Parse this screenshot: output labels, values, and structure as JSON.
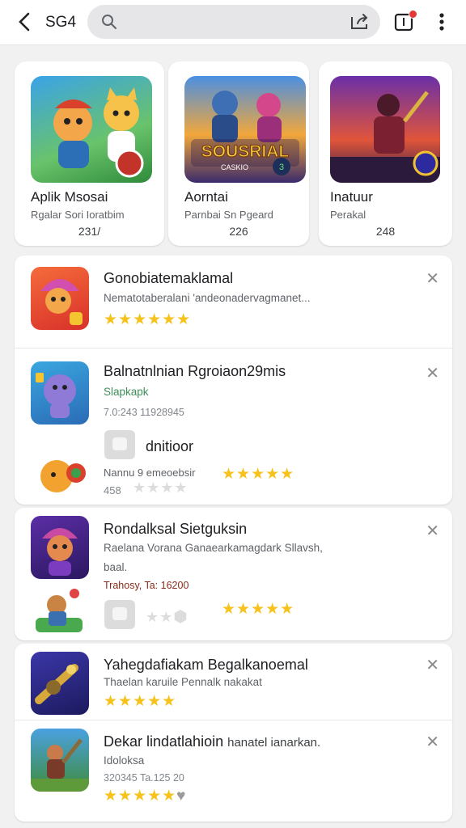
{
  "header": {
    "back_icon": "chevron-left-icon",
    "title": "SG4",
    "search_icon": "search-icon",
    "share_icon": "share-icon",
    "notification_icon": "bell-icon",
    "menu_icon": "more-vert-icon"
  },
  "featured": [
    {
      "name": "Aplik Msosai",
      "sub": "Rgalar Sori Ioratbim",
      "count": "231/"
    },
    {
      "name": "Aorntai",
      "sub": "Parnbai Sn Pgeard",
      "count": "226",
      "art_text": "SOUSRIAL",
      "art_sub": "CASKIO",
      "badge": "3"
    },
    {
      "name": "Inatuur",
      "sub": "Perakal",
      "count": "248"
    }
  ],
  "list": [
    {
      "name": "Gonobiatemaklamal",
      "desc": "Nematotaberalani 'andeonadervagmanet...",
      "stars": "★★★★★★"
    },
    {
      "name": "Balnatnlnian Rgroiaon29mis",
      "desc": "Slapkapk",
      "meta": "7.0:243 11928945",
      "sub_name": "dnitioor",
      "sub_desc": "Nannu 9 emeoebsir",
      "sub_meta": "458",
      "sub_stars": "★★★★★",
      "sub_stars_off": "★★★★"
    },
    {
      "name": "Rondalksal Sietguksin",
      "desc": "Raelana Vorana Ganaearkamagdark Sllavsh,",
      "desc2": "baal.",
      "meta": "Trahosy, Ta: 16200",
      "sub_stars_off": "★★",
      "sub_stars": "★★★★★"
    },
    {
      "name": "Yahegdafiakam Begalkanoemal",
      "desc": "Thaelan karuile Pennalk nakakat",
      "stars": "★★★★★"
    },
    {
      "name": "Dekar lindatlahioin",
      "name_tail": "hanatel ianarkan.",
      "desc": "Idoloksa",
      "meta": "320345 Ta.125 20",
      "stars": "★★★★★"
    }
  ],
  "colors": {
    "star": "#f6c21b",
    "notification_dot": "#e53935",
    "search_bg": "#e6e6e9",
    "background": "#f1f1f2"
  }
}
